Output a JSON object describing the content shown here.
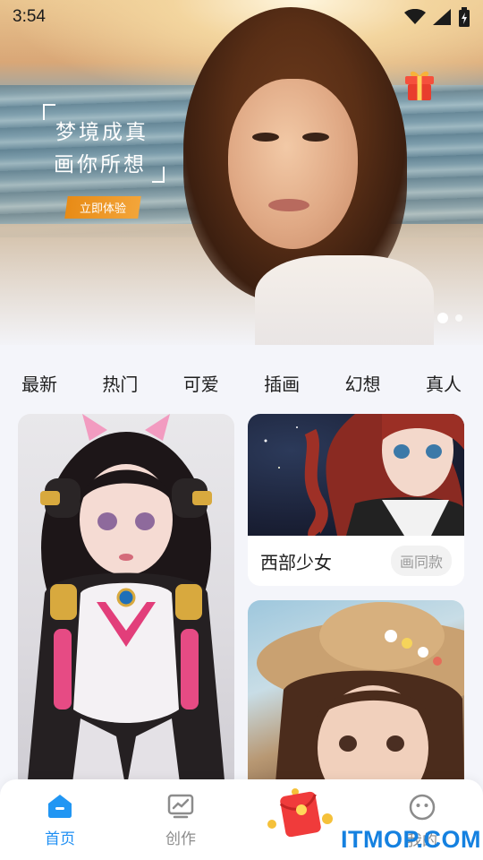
{
  "status_bar": {
    "time": "3:54",
    "icons": [
      "wifi-icon",
      "signal-icon",
      "battery-icon"
    ]
  },
  "banner": {
    "slogan_line1": "梦境成真",
    "slogan_line2": "画你所想",
    "cta_label": "立即体验",
    "gift_icon": "gift-icon",
    "carousel_pages": 2,
    "carousel_active_index": 0
  },
  "categories": [
    {
      "label": "最新"
    },
    {
      "label": "热门"
    },
    {
      "label": "可爱"
    },
    {
      "label": "插画"
    },
    {
      "label": "幻想"
    },
    {
      "label": "真人"
    }
  ],
  "cards": [
    {
      "id": "card-left",
      "title": "",
      "action": ""
    },
    {
      "id": "card-right1",
      "title": "西部少女",
      "action": "画同款"
    },
    {
      "id": "card-right2",
      "title": "",
      "action": ""
    }
  ],
  "nav": {
    "items": [
      {
        "label": "首页",
        "icon": "home-icon",
        "active": true
      },
      {
        "label": "创作",
        "icon": "create-icon",
        "active": false
      },
      {
        "label": "",
        "icon": "red-envelope-icon",
        "active": false
      },
      {
        "label": "我的",
        "icon": "face-icon",
        "active": false
      }
    ]
  },
  "watermark": "ITMOP.COM",
  "colors": {
    "accent": "#1f8ff3",
    "cta": "#ee9424",
    "background": "#f4f5fa"
  }
}
